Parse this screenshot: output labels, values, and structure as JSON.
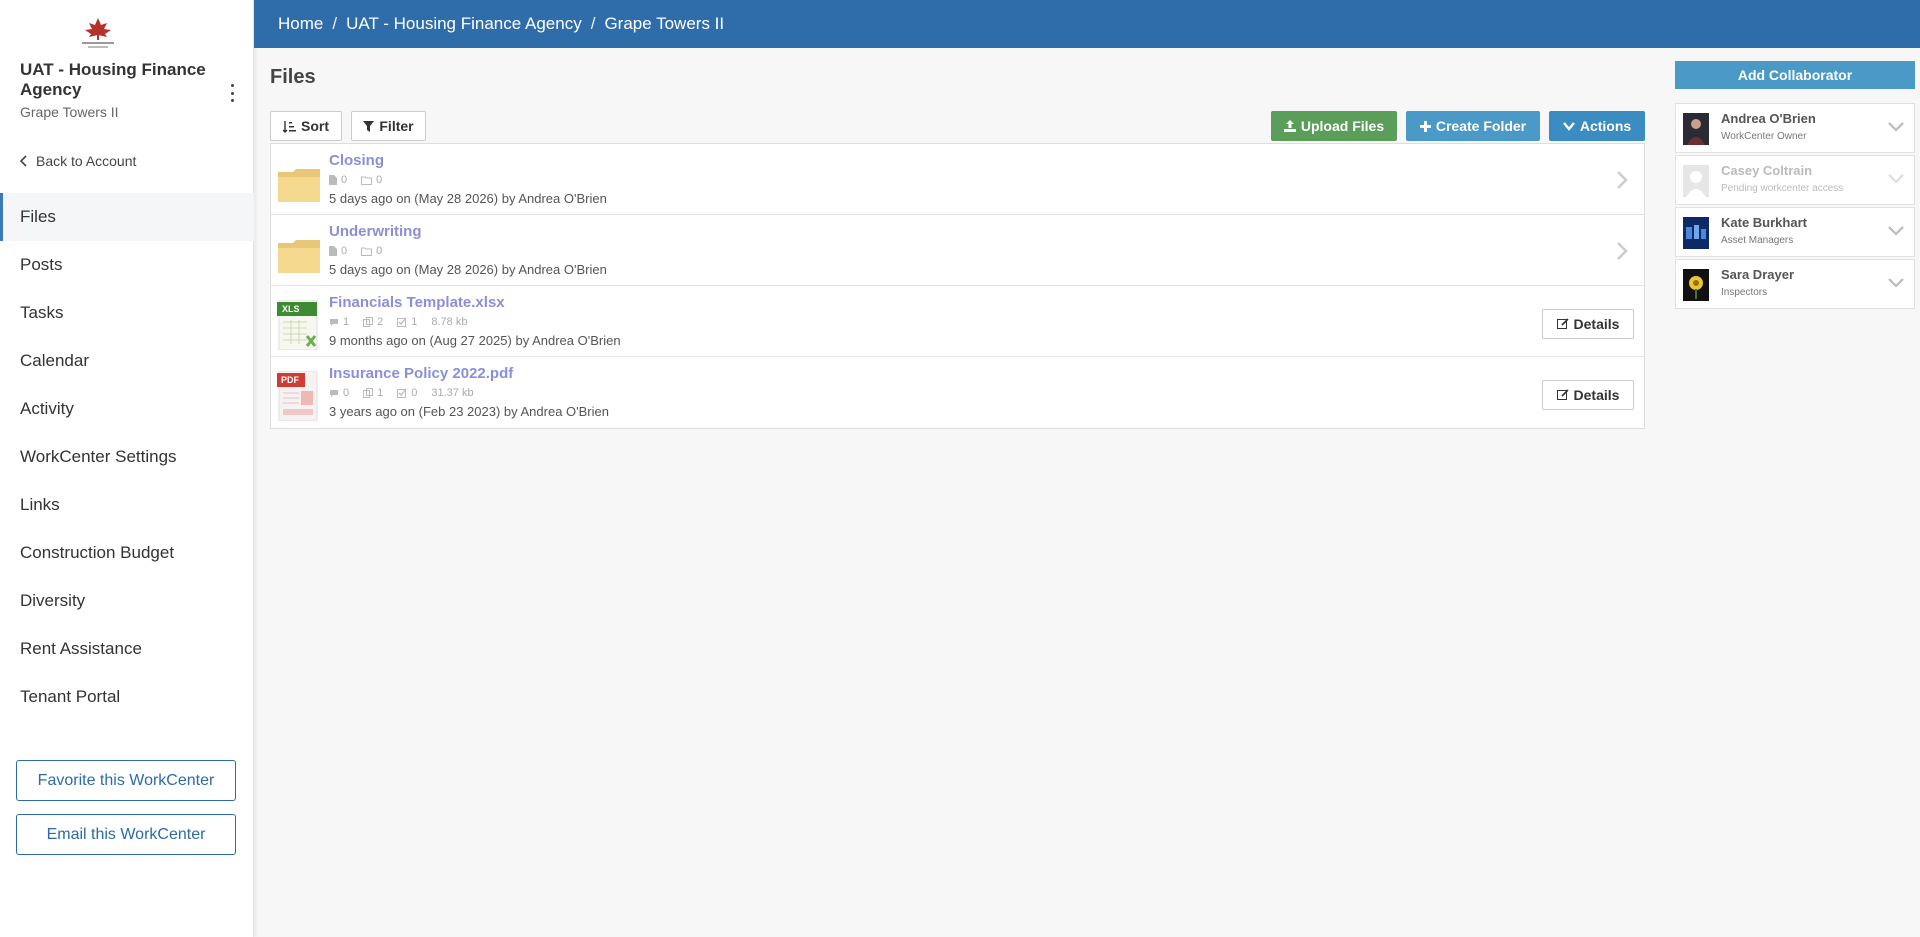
{
  "breadcrumb": [
    "Home",
    "UAT - Housing Finance Agency",
    "Grape Towers II"
  ],
  "sidebar": {
    "org_name": "UAT - Housing Finance Agency",
    "org_sub": "Grape Towers II",
    "back_label": "Back to Account",
    "items": [
      {
        "label": "Files",
        "active": true
      },
      {
        "label": "Posts"
      },
      {
        "label": "Tasks"
      },
      {
        "label": "Calendar"
      },
      {
        "label": "Activity"
      },
      {
        "label": "WorkCenter Settings"
      },
      {
        "label": "Links"
      },
      {
        "label": "Construction Budget"
      },
      {
        "label": "Diversity"
      },
      {
        "label": "Rent Assistance"
      },
      {
        "label": "Tenant Portal"
      }
    ],
    "favorite_label": "Favorite this WorkCenter",
    "email_label": "Email this WorkCenter"
  },
  "main": {
    "title": "Files",
    "sort_label": "Sort",
    "filter_label": "Filter",
    "upload_label": "Upload Files",
    "create_folder_label": "Create Folder",
    "actions_label": "Actions",
    "details_label": "Details"
  },
  "files": [
    {
      "type": "folder",
      "name": "Closing",
      "meta": [
        "0",
        "0"
      ],
      "info": "5 days ago on (May 28 2026) by Andrea O'Brien"
    },
    {
      "type": "folder",
      "name": "Underwriting",
      "meta": [
        "0",
        "0"
      ],
      "info": "5 days ago on (May 28 2026) by Andrea O'Brien"
    },
    {
      "type": "xls",
      "name": "Financials Template.xlsx",
      "meta": [
        "1",
        "2",
        "1",
        "8.78 kb"
      ],
      "info": "9 months ago on (Aug 27 2025) by Andrea O'Brien"
    },
    {
      "type": "pdf",
      "name": "Insurance Policy 2022.pdf",
      "meta": [
        "0",
        "1",
        "0",
        "31.37 kb"
      ],
      "info": "3 years ago on (Feb 23 2023) by Andrea O'Brien"
    }
  ],
  "collaborators_panel": {
    "add_label": "Add Collaborator",
    "list": [
      {
        "name": "Andrea O'Brien",
        "role": "WorkCenter Owner",
        "pending": false
      },
      {
        "name": "Casey Coltrain",
        "role": "Pending workcenter access",
        "pending": true
      },
      {
        "name": "Kate Burkhart",
        "role": "Asset Managers",
        "pending": false
      },
      {
        "name": "Sara Drayer",
        "role": "Inspectors",
        "pending": false
      }
    ]
  },
  "colors": {
    "topbar": "#2f6daa",
    "upload": "#5a9e5a",
    "create_folder": "#4a99c7",
    "actions": "#3b8cc0",
    "link": "#8b8fd9"
  },
  "icons": [
    "logo-maple-icon",
    "kebab-icon",
    "chevron-left-icon",
    "sort-icon",
    "filter-icon",
    "upload-icon",
    "plus-icon",
    "chevron-down-icon",
    "folder-icon",
    "xls-file-icon",
    "pdf-file-icon",
    "file-icon",
    "comment-icon",
    "copy-icon",
    "checkbox-icon",
    "edit-icon",
    "chevron-right-icon"
  ]
}
